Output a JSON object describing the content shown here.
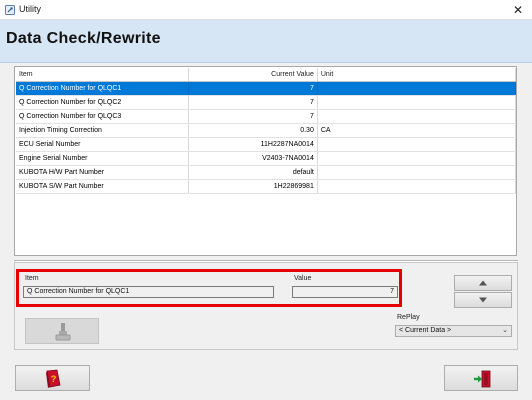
{
  "window": {
    "title": "Utility",
    "close_glyph": "✕",
    "app_icon": "app-icon"
  },
  "header": {
    "title": "Data Check/Rewrite"
  },
  "table": {
    "columns": [
      "Item",
      "Current Value",
      "Unit"
    ],
    "rows": [
      {
        "item": "Q Correction Number for QLQC1",
        "value": "7",
        "unit": "",
        "selected": true
      },
      {
        "item": "Q Correction Number for QLQC2",
        "value": "7",
        "unit": ""
      },
      {
        "item": "Q Correction Number for QLQC3",
        "value": "7",
        "unit": ""
      },
      {
        "item": "Injection Timing Correction",
        "value": "0.30",
        "unit": "CA"
      },
      {
        "item": "ECU Serial Number",
        "value": "11H2287NA0014",
        "unit": ""
      },
      {
        "item": "Engine Serial Number",
        "value": "V2403-7NA0014",
        "unit": ""
      },
      {
        "item": "KUBOTA H/W Part Number",
        "value": "default",
        "unit": ""
      },
      {
        "item": "KUBOTA S/W Part Number",
        "value": "1H22869981",
        "unit": ""
      }
    ],
    "selected_color": "#0078d7"
  },
  "edit": {
    "item_label": "Item",
    "item_value": "Q Correction Number for QLQC1",
    "value_label": "Value",
    "value_value": "7",
    "highlight_color": "#e60000"
  },
  "replay": {
    "label": "RePlay",
    "selected": "< Current Data >"
  },
  "buttons": {
    "up_icon": "arrow-up-icon",
    "down_icon": "arrow-down-icon",
    "write_icon": "write-plug-icon",
    "help_icon": "help-book-icon",
    "exit_icon": "exit-door-icon"
  }
}
